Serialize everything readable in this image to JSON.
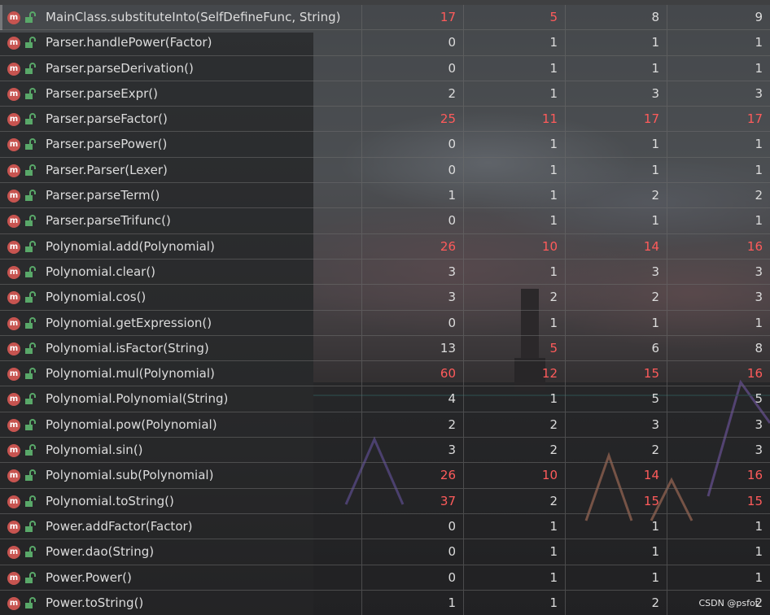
{
  "rows": [
    {
      "name": "MainClass.substituteInto(SelfDefineFunc, String)",
      "v": [
        "17",
        "5",
        "8",
        "9"
      ],
      "hi": [
        true,
        true,
        false,
        false
      ]
    },
    {
      "name": "Parser.handlePower(Factor)",
      "v": [
        "0",
        "1",
        "1",
        "1"
      ],
      "hi": [
        false,
        false,
        false,
        false
      ]
    },
    {
      "name": "Parser.parseDerivation()",
      "v": [
        "0",
        "1",
        "1",
        "1"
      ],
      "hi": [
        false,
        false,
        false,
        false
      ]
    },
    {
      "name": "Parser.parseExpr()",
      "v": [
        "2",
        "1",
        "3",
        "3"
      ],
      "hi": [
        false,
        false,
        false,
        false
      ]
    },
    {
      "name": "Parser.parseFactor()",
      "v": [
        "25",
        "11",
        "17",
        "17"
      ],
      "hi": [
        true,
        true,
        true,
        true
      ]
    },
    {
      "name": "Parser.parsePower()",
      "v": [
        "0",
        "1",
        "1",
        "1"
      ],
      "hi": [
        false,
        false,
        false,
        false
      ]
    },
    {
      "name": "Parser.Parser(Lexer)",
      "v": [
        "0",
        "1",
        "1",
        "1"
      ],
      "hi": [
        false,
        false,
        false,
        false
      ]
    },
    {
      "name": "Parser.parseTerm()",
      "v": [
        "1",
        "1",
        "2",
        "2"
      ],
      "hi": [
        false,
        false,
        false,
        false
      ]
    },
    {
      "name": "Parser.parseTrifunc()",
      "v": [
        "0",
        "1",
        "1",
        "1"
      ],
      "hi": [
        false,
        false,
        false,
        false
      ]
    },
    {
      "name": "Polynomial.add(Polynomial)",
      "v": [
        "26",
        "10",
        "14",
        "16"
      ],
      "hi": [
        true,
        true,
        true,
        true
      ]
    },
    {
      "name": "Polynomial.clear()",
      "v": [
        "3",
        "1",
        "3",
        "3"
      ],
      "hi": [
        false,
        false,
        false,
        false
      ]
    },
    {
      "name": "Polynomial.cos()",
      "v": [
        "3",
        "2",
        "2",
        "3"
      ],
      "hi": [
        false,
        false,
        false,
        false
      ]
    },
    {
      "name": "Polynomial.getExpression()",
      "v": [
        "0",
        "1",
        "1",
        "1"
      ],
      "hi": [
        false,
        false,
        false,
        false
      ]
    },
    {
      "name": "Polynomial.isFactor(String)",
      "v": [
        "13",
        "5",
        "6",
        "8"
      ],
      "hi": [
        false,
        true,
        false,
        false
      ]
    },
    {
      "name": "Polynomial.mul(Polynomial)",
      "v": [
        "60",
        "12",
        "15",
        "16"
      ],
      "hi": [
        true,
        true,
        true,
        true
      ]
    },
    {
      "name": "Polynomial.Polynomial(String)",
      "v": [
        "4",
        "1",
        "5",
        "5"
      ],
      "hi": [
        false,
        false,
        false,
        false
      ]
    },
    {
      "name": "Polynomial.pow(Polynomial)",
      "v": [
        "2",
        "2",
        "3",
        "3"
      ],
      "hi": [
        false,
        false,
        false,
        false
      ]
    },
    {
      "name": "Polynomial.sin()",
      "v": [
        "3",
        "2",
        "2",
        "3"
      ],
      "hi": [
        false,
        false,
        false,
        false
      ]
    },
    {
      "name": "Polynomial.sub(Polynomial)",
      "v": [
        "26",
        "10",
        "14",
        "16"
      ],
      "hi": [
        true,
        true,
        true,
        true
      ]
    },
    {
      "name": "Polynomial.toString()",
      "v": [
        "37",
        "2",
        "15",
        "15"
      ],
      "hi": [
        true,
        false,
        true,
        true
      ]
    },
    {
      "name": "Power.addFactor(Factor)",
      "v": [
        "0",
        "1",
        "1",
        "1"
      ],
      "hi": [
        false,
        false,
        false,
        false
      ]
    },
    {
      "name": "Power.dao(String)",
      "v": [
        "0",
        "1",
        "1",
        "1"
      ],
      "hi": [
        false,
        false,
        false,
        false
      ]
    },
    {
      "name": "Power.Power()",
      "v": [
        "0",
        "1",
        "1",
        "1"
      ],
      "hi": [
        false,
        false,
        false,
        false
      ]
    },
    {
      "name": "Power.toString()",
      "v": [
        "1",
        "1",
        "2",
        "2"
      ],
      "hi": [
        false,
        false,
        false,
        false
      ]
    }
  ],
  "badge_letter": "m",
  "icons": {
    "method": "method-icon",
    "visibility": "lock-open-icon"
  },
  "colors": {
    "highlight": "#ff5b5b",
    "normal": "#dcdcdc",
    "badge": "#c75450",
    "lock": "#59a869"
  },
  "watermark": "CSDN @psfot"
}
